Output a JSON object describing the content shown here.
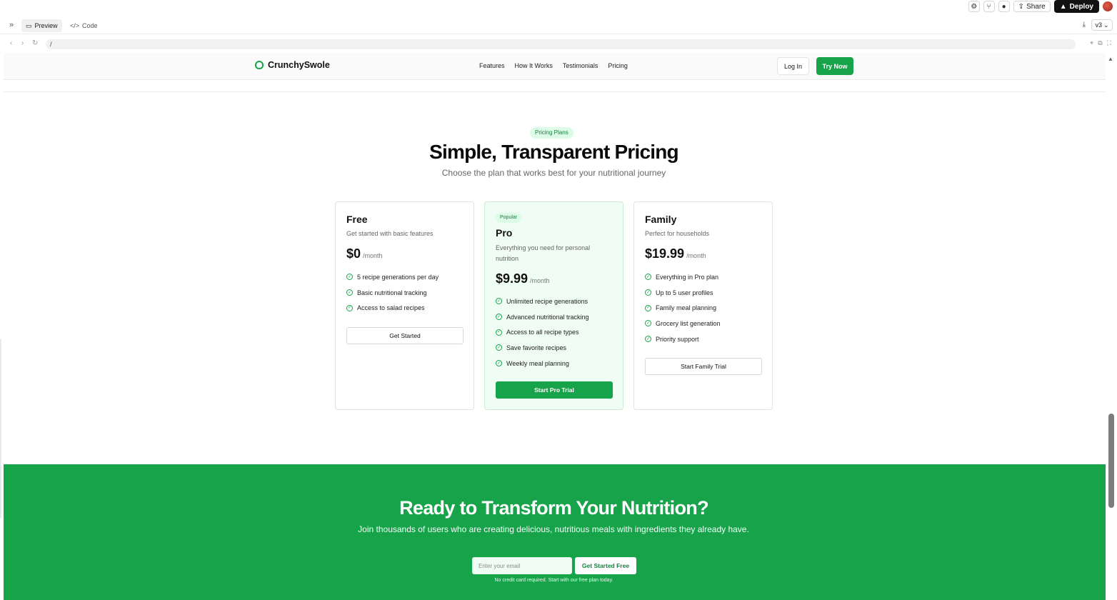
{
  "topbar": {
    "share_label": "Share",
    "deploy_label": "Deploy"
  },
  "tabs": {
    "preview_label": "Preview",
    "code_label": "Code",
    "version": "v3"
  },
  "address": {
    "url": "/"
  },
  "site_nav": {
    "brand": "CrunchySwole",
    "links": [
      "Features",
      "How It Works",
      "Testimonials",
      "Pricing"
    ],
    "login_label": "Log In",
    "try_label": "Try Now"
  },
  "pricing": {
    "badge": "Pricing Plans",
    "title": "Simple, Transparent Pricing",
    "subtitle": "Choose the plan that works best for your nutritional journey",
    "plans": [
      {
        "name": "Free",
        "description": "Get started with basic features",
        "price": "$0",
        "period": "/month",
        "features": [
          "5 recipe generations per day",
          "Basic nutritional tracking",
          "Access to salad recipes"
        ],
        "button": "Get Started"
      },
      {
        "badge": "Popular",
        "name": "Pro",
        "description": "Everything you need for personal nutrition",
        "price": "$9.99",
        "period": "/month",
        "features": [
          "Unlimited recipe generations",
          "Advanced nutritional tracking",
          "Access to all recipe types",
          "Save favorite recipes",
          "Weekly meal planning"
        ],
        "button": "Start Pro Trial"
      },
      {
        "name": "Family",
        "description": "Perfect for households",
        "price": "$19.99",
        "period": "/month",
        "features": [
          "Everything in Pro plan",
          "Up to 5 user profiles",
          "Family meal planning",
          "Grocery list generation",
          "Priority support"
        ],
        "button": "Start Family Trial"
      }
    ]
  },
  "cta": {
    "title": "Ready to Transform Your Nutrition?",
    "subtitle": "Join thousands of users who are creating delicious, nutritious meals with ingredients they already have.",
    "email_placeholder": "Enter your email",
    "button": "Get Started Free",
    "note": "No credit card required. Start with our free plan today."
  },
  "colors": {
    "accent": "#16a34a",
    "accent_light": "#dcfce7",
    "pro_card_bg": "#f0fdf4"
  },
  "icons": {
    "check": "check-circle-icon",
    "brand": "leaf-icon"
  }
}
